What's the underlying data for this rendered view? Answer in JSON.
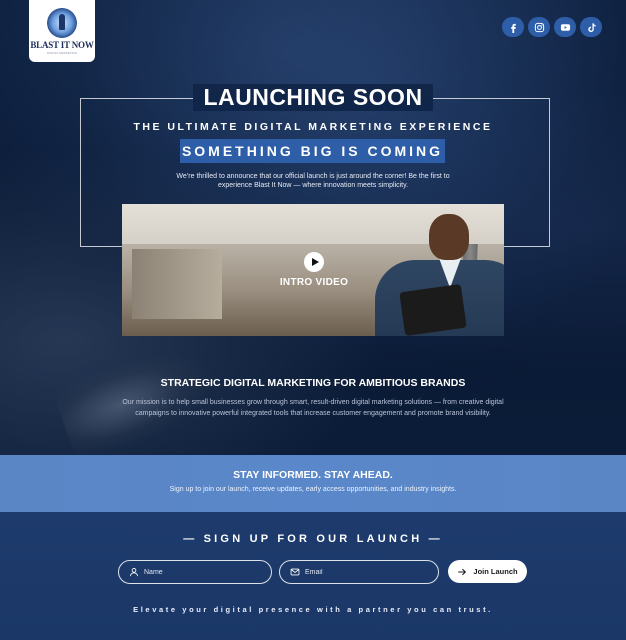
{
  "brand": {
    "logo_text": "BLAST IT NOW",
    "logo_tagline": "DIGITAL MARKETING"
  },
  "social": [
    {
      "name": "facebook-icon"
    },
    {
      "name": "instagram-icon"
    },
    {
      "name": "youtube-icon"
    },
    {
      "name": "tiktok-icon"
    }
  ],
  "hero": {
    "title": "LAUNCHING SOON",
    "subtitle": "THE ULTIMATE DIGITAL MARKETING EXPERIENCE",
    "banner": "SOMETHING BIG IS COMING",
    "announcement": "We’re thrilled to announce that our official launch is just around the corner! Be the first to experience Blast It Now — where innovation meets simplicity.",
    "video_label": "INTRO VIDEO"
  },
  "strategy": {
    "title": "STRATEGIC DIGITAL MARKETING FOR AMBITIOUS BRANDS",
    "mission": "Our mission is to help small businesses grow through smart, result-driven digital marketing solutions — from creative digital campaigns to innovative powerful integrated tools that increase customer engagement and promote brand visibility."
  },
  "informed": {
    "title": "STAY INFORMED. STAY AHEAD.",
    "subtitle": "Sign up to join our launch, receive  updates, early access opportunities, and industry insights."
  },
  "signup": {
    "title": "— SIGN UP FOR OUR LAUNCH —",
    "name_placeholder": "Name",
    "email_placeholder": "Email",
    "button_label": "Join Launch",
    "tagline": "Elevate your digital presence with a partner you can trust."
  },
  "colors": {
    "accent": "#2e5ea8",
    "band": "#5a87c9",
    "signup_bg": "#1e3b6d",
    "hero_bg": "#0d1f3d"
  }
}
